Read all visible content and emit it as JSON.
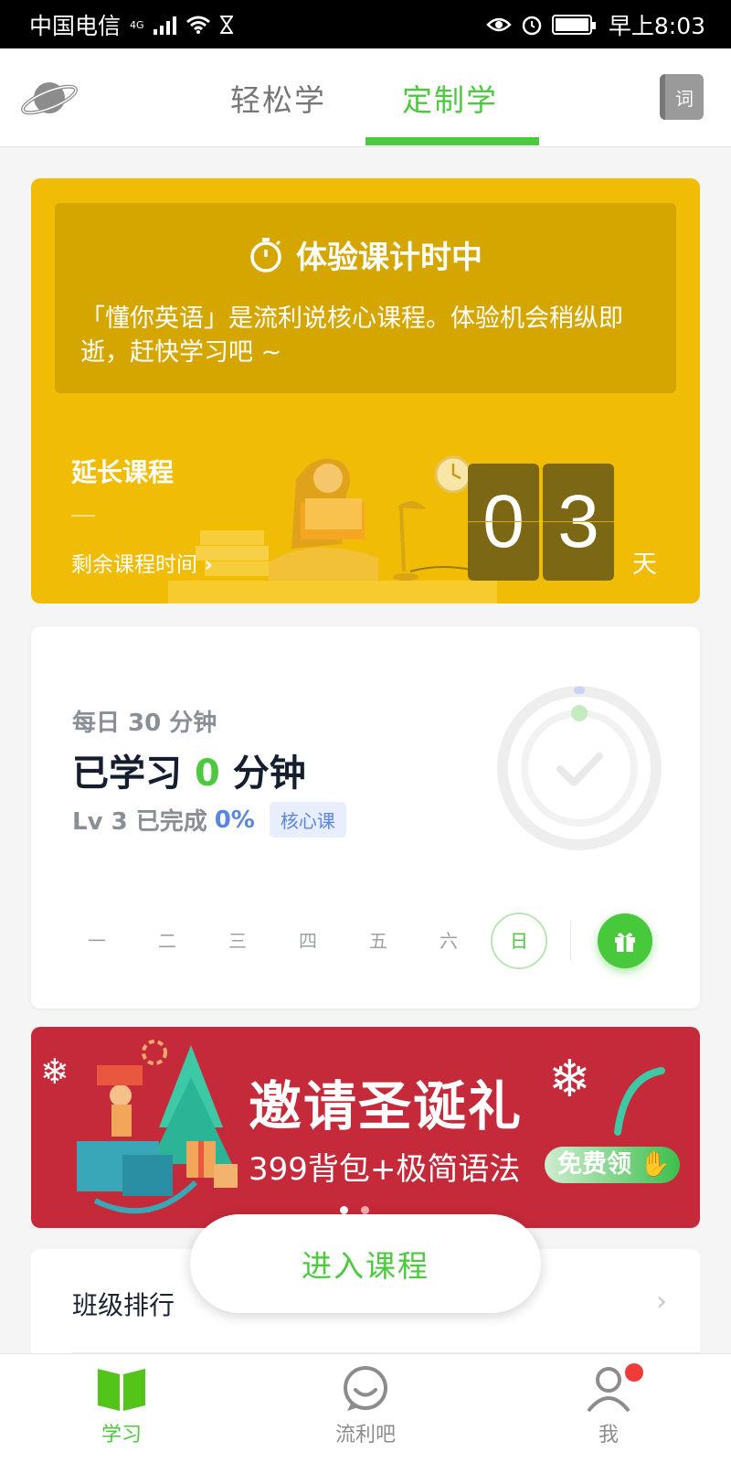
{
  "status_bar": {
    "carrier": "中国电信",
    "network": "4G",
    "time": "早上8:03"
  },
  "top_nav": {
    "tabs": [
      {
        "label": "轻松学",
        "active": false
      },
      {
        "label": "定制学",
        "active": true
      }
    ],
    "word_button": "词",
    "accent_color": "#4cc93e"
  },
  "trial_card": {
    "title": "体验课计时中",
    "description": "「懂你英语」是流利说核心课程。体验机会稍纵即逝，赶快学习吧 ~",
    "extend_label": "延长课程",
    "dash": "—",
    "remaining_label": "剩余课程时间",
    "days_digits": [
      "0",
      "3"
    ],
    "days_unit": "天",
    "background": "#f0bc06"
  },
  "study_card": {
    "daily_goal": "每日 30 分钟",
    "learned_prefix": "已学习",
    "learned_minutes": "0",
    "learned_suffix": "分钟",
    "level_prefix": "Lv 3 已完成",
    "level_percent": "0%",
    "core_badge": "核心课",
    "progress_fraction": 0,
    "weekdays": [
      "一",
      "二",
      "三",
      "四",
      "五",
      "六",
      "日"
    ],
    "today": "日"
  },
  "banner": {
    "title": "邀请圣诞礼",
    "subtitle": "399背包+极简语法",
    "cta": "免费领",
    "page_count": 2,
    "current_page": 1,
    "background": "#c52a3a"
  },
  "rank": {
    "label": "班级排行",
    "chevron": "›"
  },
  "enter_course": {
    "label": "进入课程"
  },
  "bottom_nav": {
    "items": [
      {
        "label": "学习",
        "icon": "book-icon",
        "active": true
      },
      {
        "label": "流利吧",
        "icon": "smile-bubble-icon",
        "active": false
      },
      {
        "label": "我",
        "icon": "person-icon",
        "active": false,
        "badge": true
      }
    ]
  }
}
